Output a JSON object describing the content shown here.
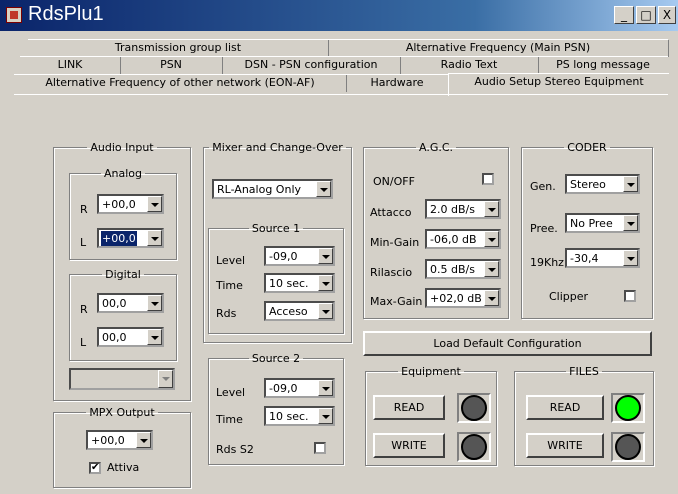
{
  "window": {
    "title": "RdsPlu1",
    "minimize": "_",
    "maximize": "□",
    "close": "X"
  },
  "tabs": {
    "row1": [
      "Transmission group list",
      "Alternative Frequency (Main PSN)"
    ],
    "row2": [
      "LINK",
      "PSN",
      "DSN - PSN configuration",
      "Radio Text",
      "PS long message"
    ],
    "row3": [
      "Alternative Frequency of other network (EON-AF)",
      "Hardware",
      "Audio Setup Stereo Equipment"
    ],
    "active": "Audio Setup Stereo Equipment"
  },
  "audio_input": {
    "title": "Audio Input",
    "analog": {
      "title": "Analog",
      "r_label": "R",
      "r_value": "+00,0",
      "l_label": "L",
      "l_value": "+00,0"
    },
    "digital": {
      "title": "Digital",
      "r_label": "R",
      "r_value": "00,0",
      "l_label": "L",
      "l_value": "00,0"
    },
    "extra_combo": ""
  },
  "mpx_output": {
    "title": "MPX Output",
    "value": "+00,0",
    "enabled_label": "Attiva",
    "enabled": true
  },
  "mixer": {
    "title": "Mixer and Change-Over",
    "mode": "RL-Analog Only",
    "source1": {
      "title": "Source 1",
      "level_label": "Level",
      "level": "-09,0",
      "time_label": "Time",
      "time": "10 sec.",
      "rds_label": "Rds",
      "rds": "Acceso"
    },
    "source2": {
      "title": "Source 2",
      "level_label": "Level",
      "level": "-09,0",
      "time_label": "Time",
      "time": "10 sec.",
      "rds_label": "Rds S2",
      "rds_checked": false
    }
  },
  "agc": {
    "title": "A.G.C.",
    "onoff_label": "ON/OFF",
    "onoff": false,
    "attacco_label": "Attacco",
    "attacco": "2.0 dB/s",
    "mingain_label": "Min-Gain",
    "mingain": "-06,0 dB",
    "rilascio_label": "Rilascio",
    "rilascio": "0.5 dB/s",
    "maxgain_label": "Max-Gain",
    "maxgain": "+02,0 dB"
  },
  "coder": {
    "title": "CODER",
    "gen_label": "Gen.",
    "gen": "Stereo",
    "pree_label": "Pree.",
    "pree": "No Pree",
    "khz_label": "19Khz",
    "khz": "-30,4",
    "clipper_label": "Clipper",
    "clipper": false
  },
  "load_default_label": "Load Default Configuration",
  "equipment": {
    "title": "Equipment",
    "read_label": "READ",
    "write_label": "WRITE",
    "read_status": "#555555",
    "write_status": "#555555"
  },
  "files": {
    "title": "FILES",
    "read_label": "READ",
    "write_label": "WRITE",
    "read_status": "#00ff00",
    "write_status": "#555555"
  }
}
